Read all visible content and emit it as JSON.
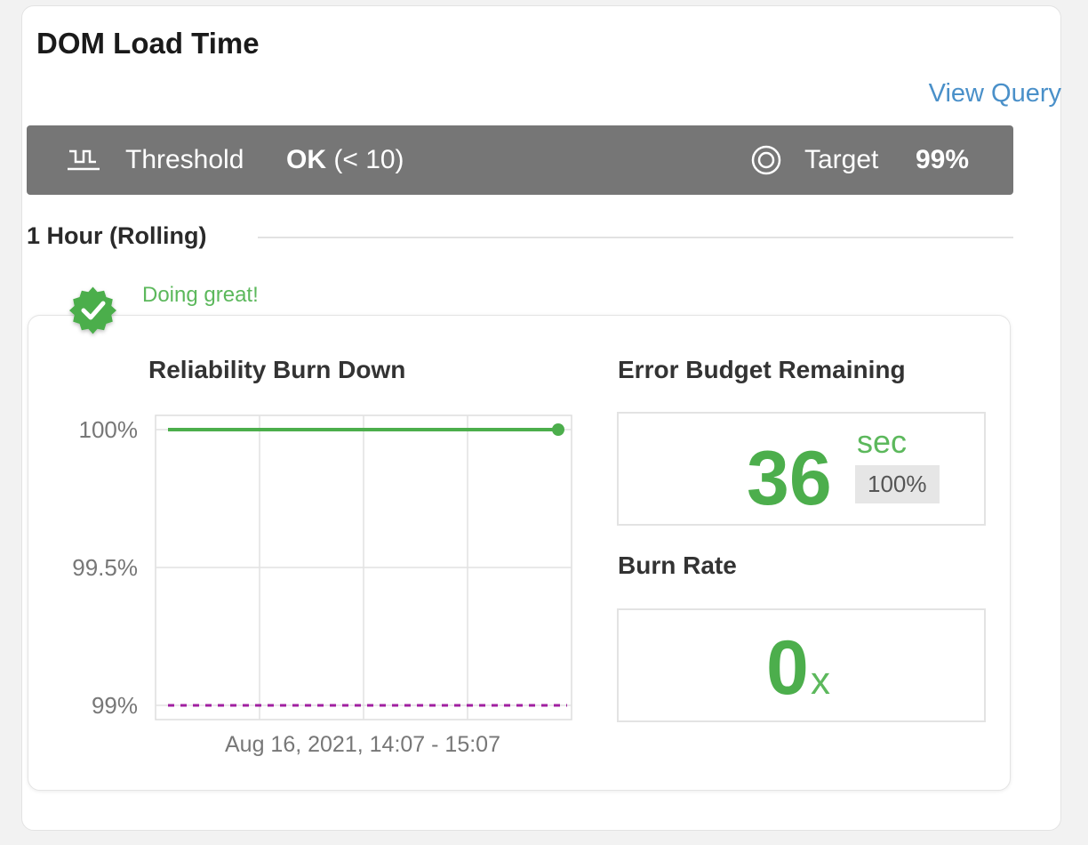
{
  "widget": {
    "title": "DOM Load Time",
    "view_query_label": "View Query"
  },
  "status_bar": {
    "threshold_icon": "threshold-icon",
    "threshold_label": "Threshold",
    "threshold_status": "OK",
    "threshold_condition": "(< 10)",
    "target_icon": "target-icon",
    "target_label": "Target",
    "target_value": "99%"
  },
  "time_window": {
    "label": "1 Hour (Rolling)"
  },
  "status": {
    "icon": "check-badge-icon",
    "message": "Doing great!",
    "color": "#5cb85c"
  },
  "burn_down": {
    "title": "Reliability Burn Down",
    "date_range": "Aug 16, 2021, 14:07 - 15:07"
  },
  "error_budget": {
    "title": "Error Budget Remaining",
    "value": "36",
    "unit": "sec",
    "percent": "100%"
  },
  "burn_rate": {
    "title": "Burn Rate",
    "value": "0",
    "unit": "x"
  },
  "colors": {
    "bar_background": "#767676",
    "success": "#4cae4c",
    "link": "#4a90c9",
    "target_line": "#a020a0"
  },
  "chart_data": {
    "type": "line",
    "xlabel": "Aug 16, 2021, 14:07 - 15:07",
    "ylabel": "",
    "ylim": [
      99,
      100
    ],
    "y_tick_labels": [
      "100%",
      "99.5%",
      "99%"
    ],
    "y_ticks": [
      100,
      99.5,
      99
    ],
    "grid": true,
    "series": [
      {
        "x": [
          0,
          1
        ],
        "values": [
          100,
          100
        ],
        "color": "#4cae4c"
      }
    ],
    "target_line": {
      "value": 99,
      "color": "#a020a0",
      "style": "dashed"
    }
  }
}
